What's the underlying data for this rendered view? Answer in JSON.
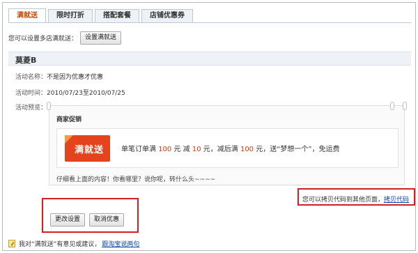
{
  "tabs": [
    {
      "label": "满就送",
      "active": true
    },
    {
      "label": "限时打折",
      "active": false
    },
    {
      "label": "搭配套餐",
      "active": false
    },
    {
      "label": "店铺优惠券",
      "active": false
    }
  ],
  "setup": {
    "text": "您可以设置多店满就送：",
    "button_label": "设置满就送"
  },
  "panel": {
    "title": "莫菱B",
    "name_label": "活动名称：",
    "name_value": "不是因为优惠才优惠",
    "time_label": "活动时间：",
    "time_value": "2010/07/23至2010/07/25",
    "preview_label": "活动预览："
  },
  "preview": {
    "title": "商家促销",
    "badge_text": "满就送",
    "line": {
      "p1": "单笔订单满",
      "amount1": "100",
      "p2": "元 减",
      "amount2": "10",
      "p3": "元，减后满",
      "amount3": "100",
      "p4": "元，送“梦想一个”，免运费"
    },
    "note": "仔细看上面的内容！你看哪里？说你呢，转什么头~~~~"
  },
  "copy": {
    "text": "您可以拷贝代码到其他页面，",
    "link": "拷贝代码"
  },
  "actions": {
    "modify_label": "更改设置",
    "cancel_label": "取消优惠"
  },
  "footer": {
    "text": "我对“满就送”有意见或建议，",
    "link": "跟淘宝说两句"
  },
  "colors": {
    "accent_red": "#d21f1f",
    "promo_price": "#d23b00",
    "badge": "#e5431e",
    "link": "#0645ad"
  }
}
